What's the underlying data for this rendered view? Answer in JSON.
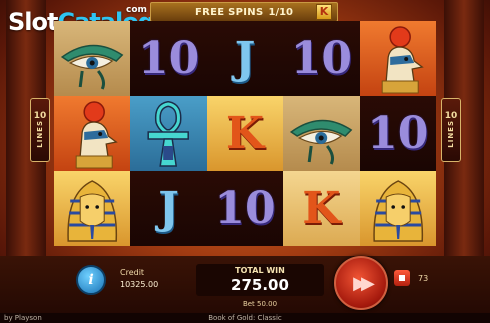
{
  "logo": {
    "slot": "Slot",
    "catalog": "Catalog",
    "com": "com"
  },
  "free_spins": {
    "label": "FREE SPINS",
    "count": "1/10",
    "feature_symbol": "K"
  },
  "lines": {
    "count": "10",
    "label": "LINES"
  },
  "reels": [
    [
      "eye-of-horus",
      "10",
      "J",
      "10",
      "horus"
    ],
    [
      "horus",
      "ankh",
      "K",
      "eye-of-horus",
      "10"
    ],
    [
      "pharaoh",
      "J",
      "10",
      "K",
      "pharaoh"
    ]
  ],
  "hud": {
    "credit_label": "Credit",
    "credit_value": "10325.00",
    "total_win_label": "TOTAL WIN",
    "total_win_value": "275.00",
    "bet_text": "Bet 50.00",
    "autoplay_count": "73"
  },
  "footer": {
    "brand": "by Playson",
    "game_name": "Book of Gold: Classic"
  },
  "colors": {
    "accent": "#2ec4f2",
    "spin": "#d72b15",
    "info": "#1a73b6",
    "gold": "#c99a44"
  }
}
